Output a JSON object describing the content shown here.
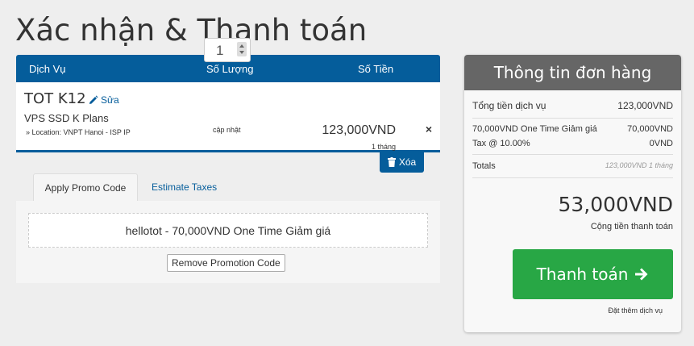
{
  "page": {
    "title": "Xác nhận & Thanh toán"
  },
  "cart": {
    "headers": {
      "service": "Dịch Vụ",
      "quantity": "Số Lượng",
      "amount": "Số Tiền"
    },
    "item": {
      "name": "TOT K12",
      "edit_label": "Sửa",
      "group": "VPS SSD K Plans",
      "config": "» Location: VNPT Hanoi - ISP IP",
      "quantity": "1",
      "update_label": "cập nhật",
      "price": "123,000VND",
      "cycle": "1 tháng",
      "remove_symbol": "×"
    },
    "remove_all_label": "Xóa"
  },
  "tabs": {
    "promo": "Apply Promo Code",
    "taxes": "Estimate Taxes"
  },
  "promo": {
    "applied": "hellotot - 70,000VND One Time Giảm giá",
    "remove_label": "Remove Promotion Code"
  },
  "summary": {
    "title": "Thông tin đơn hàng",
    "subtotal_label": "Tổng tiền dịch vụ",
    "subtotal_value": "123,000VND",
    "discount_label": "70,000VND One Time Giảm giá",
    "discount_value": "70,000VND",
    "tax_label": "Tax @ 10.00%",
    "tax_value": "0VND",
    "totals_label": "Totals",
    "totals_value": "123,000VND 1 tháng",
    "grand_total": "53,000VND",
    "grand_total_label": "Cộng tiền thanh toán",
    "checkout_label": "Thanh toán",
    "continue_label": "Đặt thêm dịch vụ"
  },
  "colors": {
    "primary": "#055d9b",
    "success": "#28a745",
    "summary_header": "#666666"
  }
}
